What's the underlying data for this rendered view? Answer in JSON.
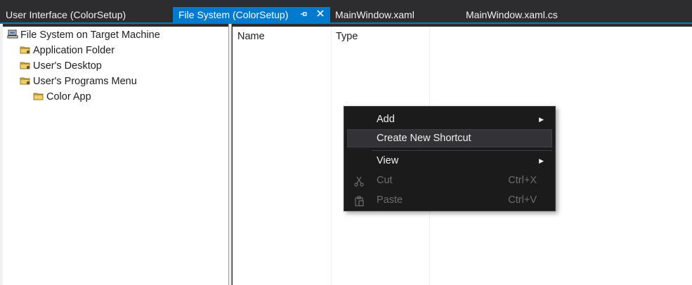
{
  "tabs": [
    {
      "label": "User Interface (ColorSetup)",
      "active": false
    },
    {
      "label": "File System (ColorSetup)",
      "active": true
    },
    {
      "label": "MainWindow.xaml",
      "active": false
    },
    {
      "label": "MainWindow.xaml.cs",
      "active": false
    }
  ],
  "tree": {
    "root": "File System on Target Machine",
    "items": [
      "Application Folder",
      "User's Desktop",
      "User's Programs Menu",
      "Color App"
    ]
  },
  "list": {
    "columns": [
      "Name",
      "Type"
    ]
  },
  "context_menu": {
    "items": [
      {
        "label": "Add",
        "shortcut": "",
        "submenu": true
      },
      {
        "label": "Create New Shortcut",
        "shortcut": "",
        "submenu": false
      },
      {
        "label": "View",
        "shortcut": "",
        "submenu": true
      },
      {
        "label": "Cut",
        "shortcut": "Ctrl+X",
        "submenu": false
      },
      {
        "label": "Paste",
        "shortcut": "Ctrl+V",
        "submenu": false
      }
    ]
  },
  "colors": {
    "accent": "#007acc",
    "menu_bg": "#1b1b1c",
    "tab_bar_bg": "#2d2d30"
  },
  "icons": {
    "pin": "pin-icon",
    "close": "close-icon",
    "computer": "computer-icon",
    "folder": "folder-icon",
    "special_folder": "special-folder-icon",
    "cut": "scissors-icon",
    "paste": "clipboard-icon",
    "submenu": "submenu-arrow-icon"
  }
}
